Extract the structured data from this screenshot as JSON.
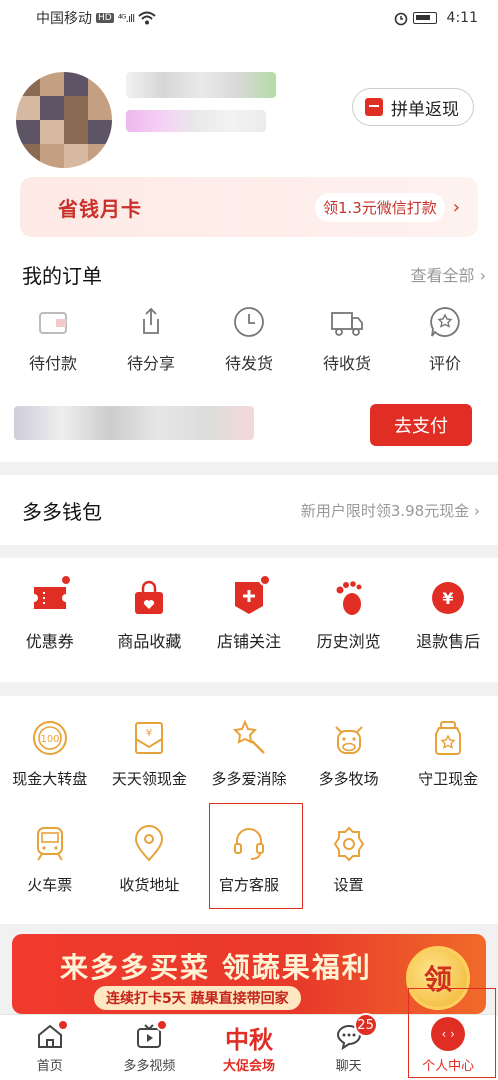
{
  "status_bar": {
    "carrier": "中国移动",
    "network_badge": "HD",
    "signal": "⁴ᴳ.ıll",
    "time": "4:11"
  },
  "header": {
    "pdd_cashback_label": "拼单返现"
  },
  "savings_card": {
    "title": "省钱月卡",
    "tag": "领1.3元微信打款"
  },
  "orders": {
    "title": "我的订单",
    "view_all": "查看全部 ›",
    "items": [
      {
        "label": "待付款",
        "icon": "wallet-icon"
      },
      {
        "label": "待分享",
        "icon": "share-icon"
      },
      {
        "label": "待发货",
        "icon": "clock-icon"
      },
      {
        "label": "待收货",
        "icon": "truck-icon"
      },
      {
        "label": "评价",
        "icon": "review-icon"
      }
    ],
    "pay_button": "去支付"
  },
  "wallet": {
    "title": "多多钱包",
    "promo": "新用户限时领3.98元现金 ›"
  },
  "tools": [
    {
      "label": "优惠券",
      "icon": "coupon-icon"
    },
    {
      "label": "商品收藏",
      "icon": "favorite-bag-icon"
    },
    {
      "label": "店铺关注",
      "icon": "store-follow-icon"
    },
    {
      "label": "历史浏览",
      "icon": "footprint-icon"
    },
    {
      "label": "退款售后",
      "icon": "refund-icon"
    }
  ],
  "services": {
    "row1": [
      {
        "label": "现金大转盘",
        "icon": "wheel-icon"
      },
      {
        "label": "天天领现金",
        "icon": "cash-envelope-icon"
      },
      {
        "label": "多多爱消除",
        "icon": "star-wand-icon"
      },
      {
        "label": "多多牧场",
        "icon": "cow-icon"
      },
      {
        "label": "守卫现金",
        "icon": "cash-jar-icon"
      }
    ],
    "row2": [
      {
        "label": "火车票",
        "icon": "train-icon"
      },
      {
        "label": "收货地址",
        "icon": "location-icon"
      },
      {
        "label": "官方客服",
        "icon": "headset-icon"
      },
      {
        "label": "设置",
        "icon": "settings-icon"
      }
    ]
  },
  "promo_banner": {
    "title": "来多多买菜 领蔬果福利",
    "subtitle": "连续打卡5天 蔬果直接带回家",
    "coin_text": "领"
  },
  "tabbar": {
    "home": "首页",
    "video": "多多视频",
    "promo_main": "中秋",
    "promo_sub": "大促会场",
    "chat": "聊天",
    "chat_count": "25",
    "me": "个人中心"
  },
  "colors": {
    "accent": "#e02e24",
    "service_icon": "#e8a23a"
  }
}
